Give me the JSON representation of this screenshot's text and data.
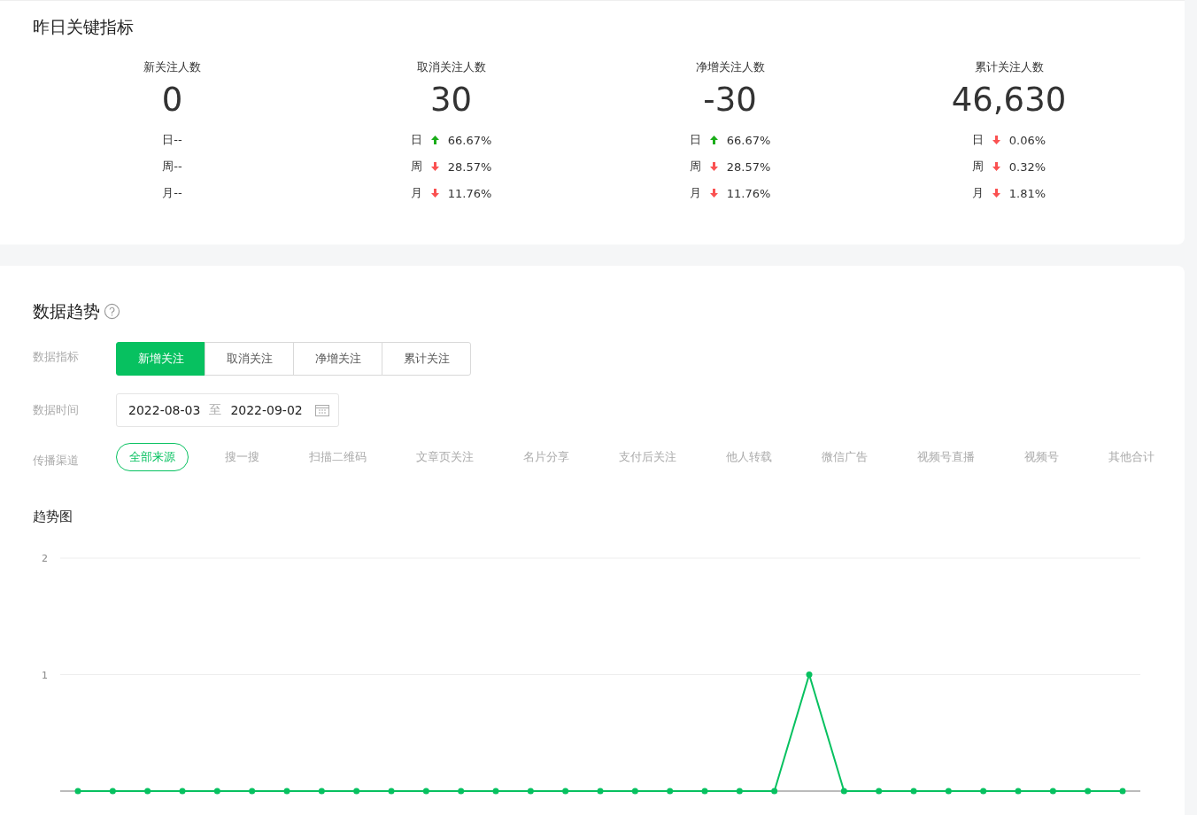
{
  "summary": {
    "title": "昨日关键指标",
    "metrics": [
      {
        "label": "新关注人数",
        "value": "0",
        "changes": [
          {
            "label": "日--"
          },
          {
            "label": "周--"
          },
          {
            "label": "月--"
          }
        ]
      },
      {
        "label": "取消关注人数",
        "value": "30",
        "changes": [
          {
            "label": "日",
            "rising": true,
            "value": "66.67%"
          },
          {
            "label": "周",
            "rising": false,
            "value": "28.57%"
          },
          {
            "label": "月",
            "rising": false,
            "value": "11.76%"
          }
        ]
      },
      {
        "label": "净增关注人数",
        "value": "-30",
        "changes": [
          {
            "label": "日",
            "rising": true,
            "value": "66.67%"
          },
          {
            "label": "周",
            "rising": false,
            "value": "28.57%"
          },
          {
            "label": "月",
            "rising": false,
            "value": "11.76%"
          }
        ]
      },
      {
        "label": "累计关注人数",
        "value": "46,630",
        "changes": [
          {
            "label": "日",
            "rising": false,
            "value": "0.06%"
          },
          {
            "label": "周",
            "rising": false,
            "value": "0.32%"
          },
          {
            "label": "月",
            "rising": false,
            "value": "1.81%"
          }
        ]
      }
    ]
  },
  "trend": {
    "title": "数据趋势",
    "indicator": {
      "label": "数据指标",
      "options": [
        {
          "label": "新增关注",
          "selected": true
        },
        {
          "label": "取消关注",
          "selected": false
        },
        {
          "label": "净增关注",
          "selected": false
        },
        {
          "label": "累计关注",
          "selected": false
        }
      ]
    },
    "time": {
      "label": "数据时间",
      "start": "2022-08-03",
      "separator": "至",
      "end": "2022-09-02"
    },
    "channel": {
      "label": "传播渠道",
      "options": [
        {
          "label": "全部来源",
          "selected": true
        },
        {
          "label": "搜一搜",
          "selected": false
        },
        {
          "label": "扫描二维码",
          "selected": false
        },
        {
          "label": "文章页关注",
          "selected": false
        },
        {
          "label": "名片分享",
          "selected": false
        },
        {
          "label": "支付后关注",
          "selected": false
        },
        {
          "label": "他人转载",
          "selected": false
        },
        {
          "label": "微信广告",
          "selected": false
        },
        {
          "label": "视频号直播",
          "selected": false
        },
        {
          "label": "视频号",
          "selected": false
        },
        {
          "label": "其他合计",
          "selected": false
        }
      ]
    },
    "chart_title": "趋势图",
    "chart_data": {
      "type": "line",
      "ylim": [
        0,
        2
      ],
      "yticks": [
        1,
        2
      ],
      "series": [
        {
          "color": "#07c160",
          "marker": true,
          "values": [
            0,
            0,
            0,
            0,
            0,
            0,
            0,
            0,
            0,
            0,
            0,
            0,
            0,
            0,
            0,
            0,
            0,
            0,
            0,
            0,
            0,
            1,
            0,
            0,
            0,
            0,
            0,
            0,
            0,
            0,
            0
          ]
        }
      ]
    }
  }
}
